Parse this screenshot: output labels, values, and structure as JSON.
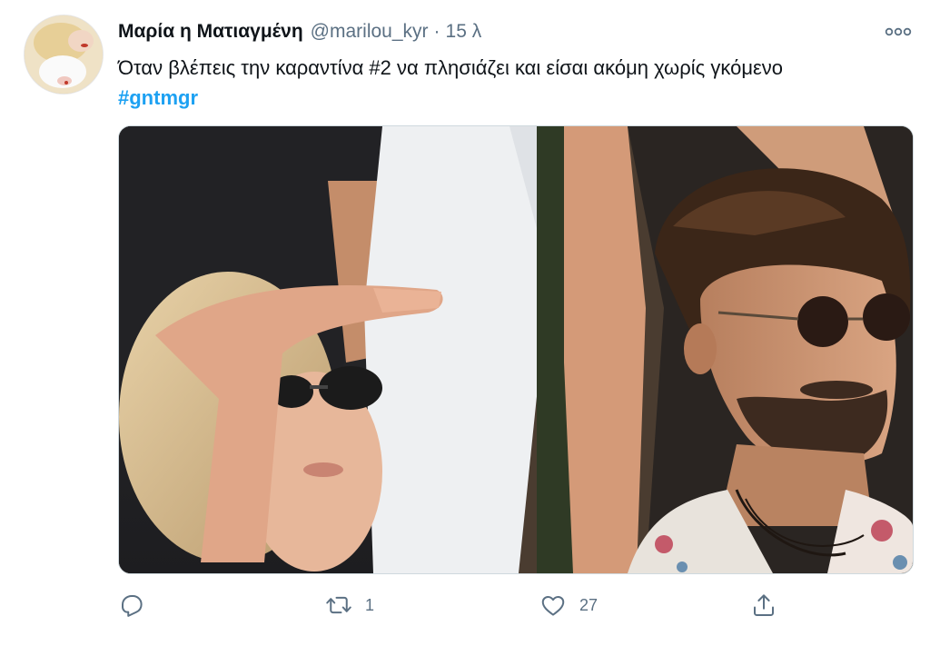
{
  "tweet": {
    "display_name": "Μαρία η Ματιαγμένη",
    "handle": "@marilou_kyr",
    "separator": "·",
    "time": "15 λ",
    "text": "Όταν βλέπεις την καραντίνα #2 να πλησιάζει και είσαι ακόμη χωρίς γκόμενο",
    "hashtag": "#gntmgr"
  },
  "actions": {
    "reply_icon": "reply-icon",
    "retweet_icon": "retweet-icon",
    "retweet_count": "1",
    "like_icon": "heart-icon",
    "like_count": "27",
    "share_icon": "share-icon"
  },
  "colors": {
    "accent": "#1da1f2",
    "secondary_text": "#5b7083",
    "primary_text": "#0f1419"
  }
}
